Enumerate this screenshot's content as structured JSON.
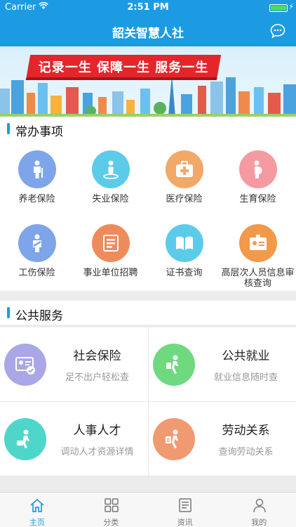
{
  "status_bar": {
    "carrier": "Carrier",
    "time": "2:51 PM"
  },
  "nav": {
    "title": "韶关智慧人社",
    "action_icon": "chat-bubble-icon"
  },
  "banner": {
    "slogan": "记录一生 保障一生 服务一生"
  },
  "common": {
    "title": "常办事项",
    "items": [
      {
        "label": "养老保险",
        "icon": "elderly-person-icon",
        "color": "#7ea4ea"
      },
      {
        "label": "失业保险",
        "icon": "person-standing-icon",
        "color": "#5ccbea"
      },
      {
        "label": "医疗保险",
        "icon": "medical-kit-icon",
        "color": "#f2a867"
      },
      {
        "label": "生育保险",
        "icon": "pregnant-woman-icon",
        "color": "#f59aa0"
      },
      {
        "label": "工伤保险",
        "icon": "injured-worker-icon",
        "color": "#7ea4ea"
      },
      {
        "label": "事业单位招聘",
        "icon": "document-list-icon",
        "color": "#ee8b5c"
      },
      {
        "label": "证书查询",
        "icon": "open-book-icon",
        "color": "#5ccbea"
      },
      {
        "label": "高层次人员信息审核查询",
        "icon": "id-badge-icon",
        "color": "#f2994a"
      }
    ]
  },
  "public": {
    "title": "公共服务",
    "items": [
      {
        "title": "社会保险",
        "subtitle": "足不出户轻松查",
        "icon": "id-card-check-icon",
        "color": "#a9a7e7"
      },
      {
        "title": "公共就业",
        "subtitle": "就业信息随时查",
        "icon": "walking-person-icon",
        "color": "#6fd97f"
      },
      {
        "title": "人事人才",
        "subtitle": "调动人才资源详情",
        "icon": "person-with-briefcase-icon",
        "color": "#4fd6cb"
      },
      {
        "title": "劳动关系",
        "subtitle": "查询劳动关系",
        "icon": "person-with-document-icon",
        "color": "#f09a72"
      }
    ]
  },
  "tabs": [
    {
      "label": "主页",
      "icon": "home-icon",
      "active": true
    },
    {
      "label": "分类",
      "icon": "grid-icon",
      "active": false
    },
    {
      "label": "资讯",
      "icon": "newspaper-icon",
      "active": false
    },
    {
      "label": "我的",
      "icon": "user-icon",
      "active": false
    }
  ],
  "colors": {
    "primary": "#1d9be2",
    "banner_red": "#e4262b"
  }
}
